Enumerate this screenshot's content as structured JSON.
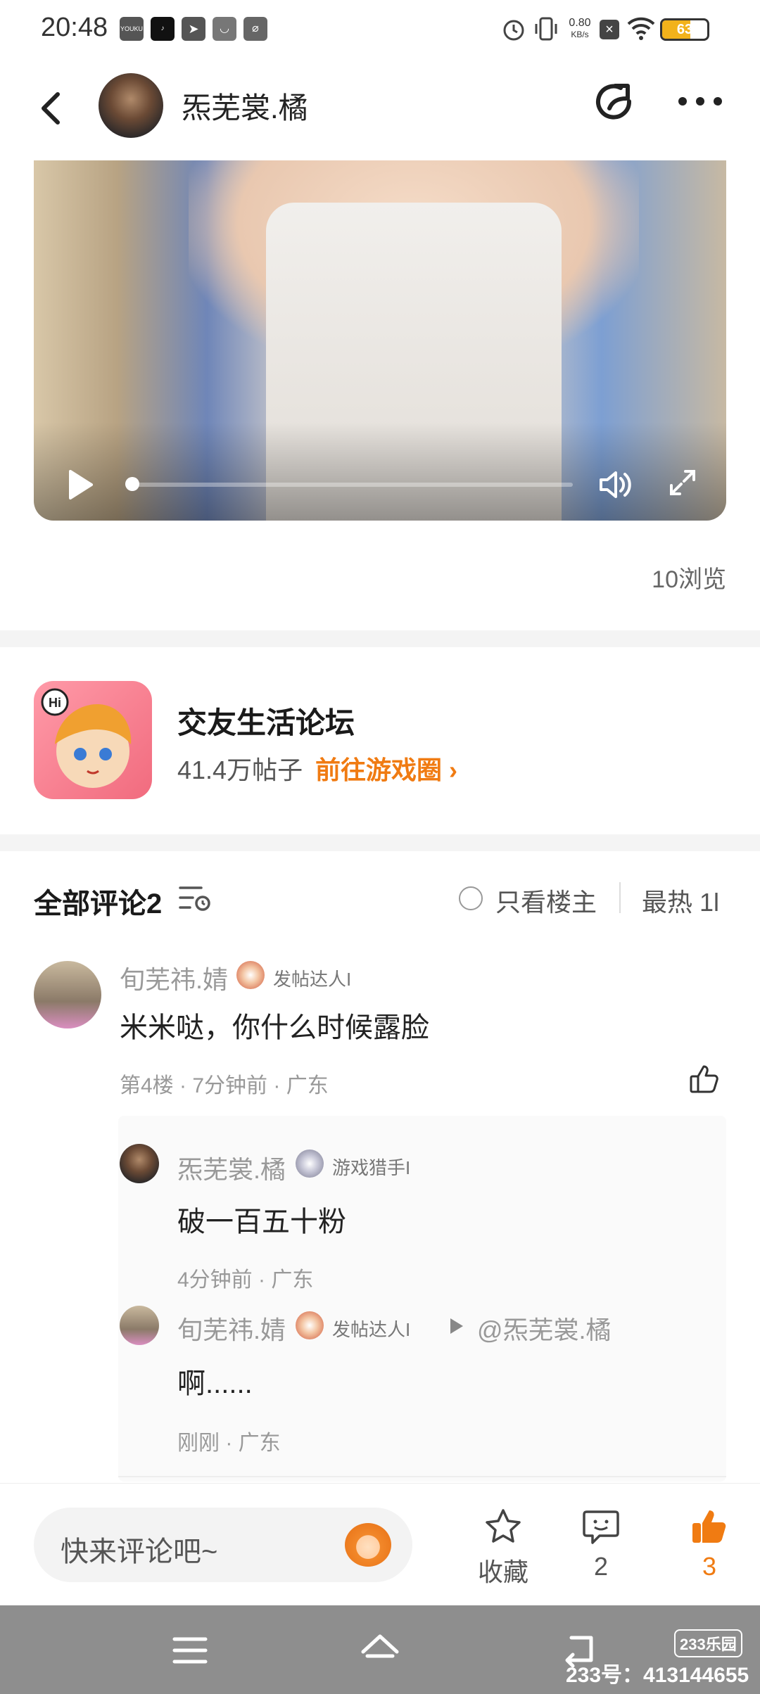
{
  "status_bar": {
    "time": "20:48",
    "net_speed_value": "0.80",
    "net_speed_unit": "KB/s",
    "battery": "63",
    "battery_level": 0.63,
    "app_icons": [
      "youku-icon",
      "tiktok-icon",
      "telegram-icon",
      "cup-icon",
      "leaf-icon"
    ],
    "app_icon_labels": [
      "YOUKU",
      "",
      "",
      "",
      ""
    ]
  },
  "header": {
    "username": "炁芜裳.橘"
  },
  "video": {
    "progress": 0.0
  },
  "post": {
    "views": "10浏览"
  },
  "forum": {
    "name": "交友生活论坛",
    "posts": "41.4万帖子",
    "go_label": "前往游戏圈 ›",
    "icon_text": "Hi"
  },
  "comments_header": {
    "title": "全部评论2",
    "only_host": "只看楼主",
    "sort": "最热 1l"
  },
  "comments": [
    {
      "name": "旬芜祎.婧",
      "badge": "发帖达人I",
      "text": "米米哒，你什么时候露脸",
      "meta": "第4楼 · 7分钟前 · 广东"
    }
  ],
  "replies": [
    {
      "name": "炁芜裳.橘",
      "badge": "游戏猎手I",
      "text": "破一百五十粉",
      "meta": "4分钟前 · 广东"
    },
    {
      "name": "旬芜祎.婧",
      "badge": "发帖达人I",
      "reply_to": "@炁芜裳.橘",
      "text": "啊......",
      "meta": "刚刚 · 广东"
    }
  ],
  "bottom_bar": {
    "placeholder": "快来评论吧~",
    "favorite": "收藏",
    "comments": "2",
    "likes": "3"
  },
  "watermark": {
    "logo": "233乐园",
    "id": "233号：413144655"
  },
  "colors": {
    "accent": "#f07b12",
    "muted": "#999999"
  }
}
